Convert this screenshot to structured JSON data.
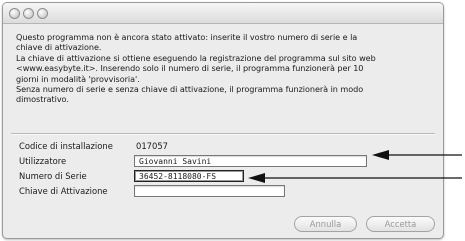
{
  "window": {
    "title": ""
  },
  "message": {
    "lines": [
      "Questo programma non è ancora stato attivato: inserite il vostro numero di serie e la",
      "chiave di attivazione.",
      "La chiave di attivazione si ottiene eseguendo la registrazione del programma sul sito web",
      "<www.easybyte.it>. Inserendo solo il numero di serie, il programma funzionerà per 10",
      "giorni in modalità 'provvisoria'.",
      "Senza numero di serie e senza chiave di attivazione, il programma funzionerà in modo",
      "dimostrativo."
    ]
  },
  "form": {
    "install_code_label": "Codice di installazione",
    "install_code_value": "017057",
    "user_label": "Utilizzatore",
    "user_value": "Giovanni Savini",
    "serial_label": "Numero di Serie",
    "serial_value": "36452-8118080-FS",
    "activation_label": "Chiave di Attivazione",
    "activation_value": ""
  },
  "buttons": {
    "cancel_label": "Annulla",
    "accept_label": "Accetta"
  }
}
